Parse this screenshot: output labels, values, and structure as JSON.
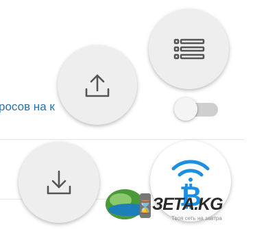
{
  "row": {
    "label": "росов на  к",
    "toggle_state": "off"
  },
  "actions": {
    "list": "list-icon",
    "upload": "upload-icon",
    "download": "download-icon",
    "bitcoin": "bitcoin-wireless-icon"
  },
  "watermark": {
    "brand": "ЗЕТА.KG",
    "tagline": "Твоя сеть на завтра"
  },
  "colors": {
    "link_text": "#2c6fa8",
    "fab_bg": "#eeeeee",
    "icon": "#555555",
    "bitcoin": "#1a8fe3"
  }
}
